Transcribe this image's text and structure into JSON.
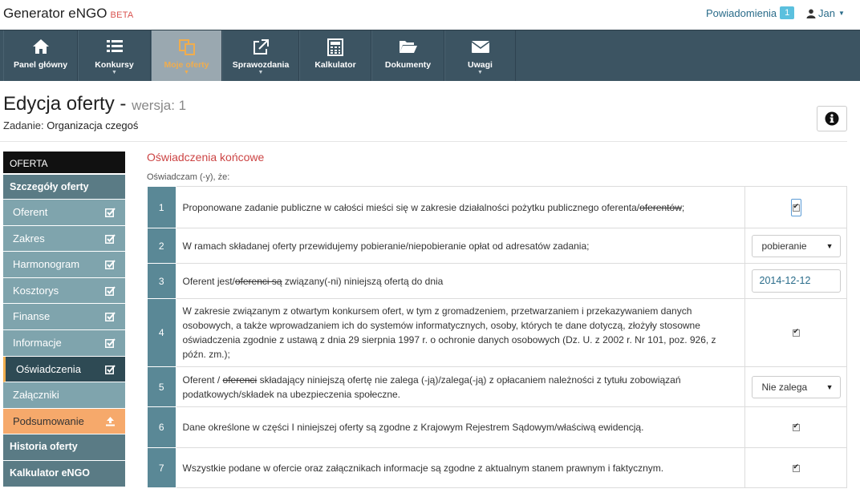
{
  "app": {
    "title": "Generator eNGO",
    "badge": "BETA"
  },
  "topbar": {
    "notifications_label": "Powiadomienia",
    "notifications_count": "1",
    "user_name": "Jan"
  },
  "nav": [
    {
      "label": "Panel główny",
      "icon": "home-icon",
      "dropdown": false,
      "active": false
    },
    {
      "label": "Konkursy",
      "icon": "list-icon",
      "dropdown": true,
      "active": false
    },
    {
      "label": "Moje oferty",
      "icon": "copy-icon",
      "dropdown": true,
      "active": true
    },
    {
      "label": "Sprawozdania",
      "icon": "external-link-icon",
      "dropdown": true,
      "active": false
    },
    {
      "label": "Kalkulator",
      "icon": "calculator-icon",
      "dropdown": false,
      "active": false
    },
    {
      "label": "Dokumenty",
      "icon": "folder-open-icon",
      "dropdown": false,
      "active": false
    },
    {
      "label": "Uwagi",
      "icon": "envelope-icon",
      "dropdown": true,
      "active": false
    }
  ],
  "header": {
    "title": "Edycja oferty",
    "dash": "-",
    "version": "wersja: 1",
    "task_label": "Zadanie:",
    "task_name": "Organizacja czegoś"
  },
  "sidebar": {
    "header": "OFERTA",
    "group": "Szczegóły oferty",
    "items": [
      {
        "label": "Oferent",
        "status": "check"
      },
      {
        "label": "Zakres",
        "status": "check"
      },
      {
        "label": "Harmonogram",
        "status": "check"
      },
      {
        "label": "Kosztorys",
        "status": "check"
      },
      {
        "label": "Finanse",
        "status": "check"
      },
      {
        "label": "Informacje",
        "status": "check"
      },
      {
        "label": "Oświadczenia",
        "status": "check"
      },
      {
        "label": "Załączniki",
        "status": "none"
      },
      {
        "label": "Podsumowanie",
        "status": "upload"
      }
    ],
    "footer": [
      "Historia oferty",
      "Kalkulator eNGO"
    ]
  },
  "content": {
    "section_title": "Oświadczenia końcowe",
    "declaration": "Oświadczam (-y), że:",
    "rows": [
      {
        "num": "1",
        "a": "Proponowane zadanie publiczne w całości mieści się w zakresie działalności pożytku publicznego oferenta/",
        "s": "oferentów",
        "b": ";"
      },
      {
        "num": "2",
        "a": "W ramach składanej oferty przewidujemy pobieranie/niepobieranie opłat od adresatów zadania;",
        "select": "pobieranie"
      },
      {
        "num": "3",
        "a": "Oferent jest/",
        "s": "oferenci są",
        "b": " związany(-ni) niniejszą ofertą do dnia",
        "date": "2014-12-12"
      },
      {
        "num": "4",
        "a": "W zakresie związanym z otwartym konkursem ofert, w tym z gromadzeniem, przetwarzaniem i przekazywaniem danych osobowych, a także wprowadzaniem ich do systemów informatycznych, osoby, których te dane dotyczą, złożyły stosowne oświadczenia zgodnie z ustawą z dnia 29 sierpnia 1997 r. o ochronie danych osobowych (Dz. U. z 2002 r. Nr 101, poz. 926, z późn. zm.);"
      },
      {
        "num": "5",
        "a": "Oferent / ",
        "s": "oferenci",
        "b": " składający niniejszą ofertę nie zalega (-ją)/zalega(-ją) z opłacaniem należności z tytułu zobowiązań podatkowych/składek na ubezpieczenia społeczne.",
        "select": "Nie zalega"
      },
      {
        "num": "6",
        "a": "Dane określone w części I niniejszej oferty są zgodne z Krajowym Rejestrem Sądowym/właściwą ewidencją."
      },
      {
        "num": "7",
        "a": "Wszystkie podane w ofercie oraz załącznikach informacje są zgodne z aktualnym stanem prawnym i faktycznym."
      }
    ]
  }
}
